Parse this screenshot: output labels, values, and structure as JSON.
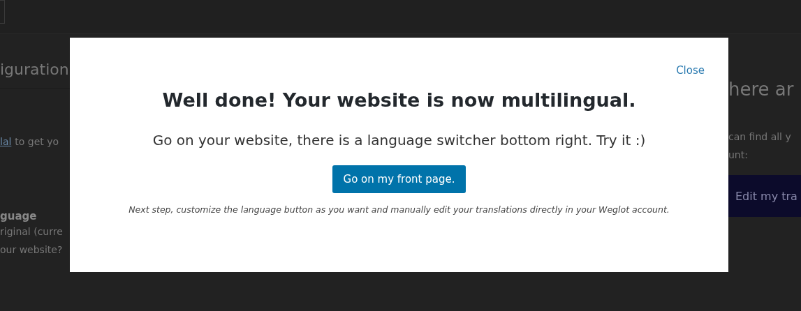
{
  "background": {
    "left": {
      "heading": "iguration",
      "link": "lal",
      "link_tail": "to get yo",
      "field_label": "guage",
      "field_help": [
        "riginal (curre",
        "our website?"
      ]
    },
    "right": {
      "heading": "here ar",
      "text": [
        "can find all y",
        "unt:"
      ],
      "button": "Edit my tra"
    }
  },
  "modal": {
    "close": "Close",
    "title": "Well done! Your website is now multilingual.",
    "subtitle": "Go on your website, there is a language switcher bottom right. Try it :)",
    "button": "Go on my front page.",
    "note": "Next step, customize the language button as you want and manually edit your translations directly in your Weglot account."
  }
}
